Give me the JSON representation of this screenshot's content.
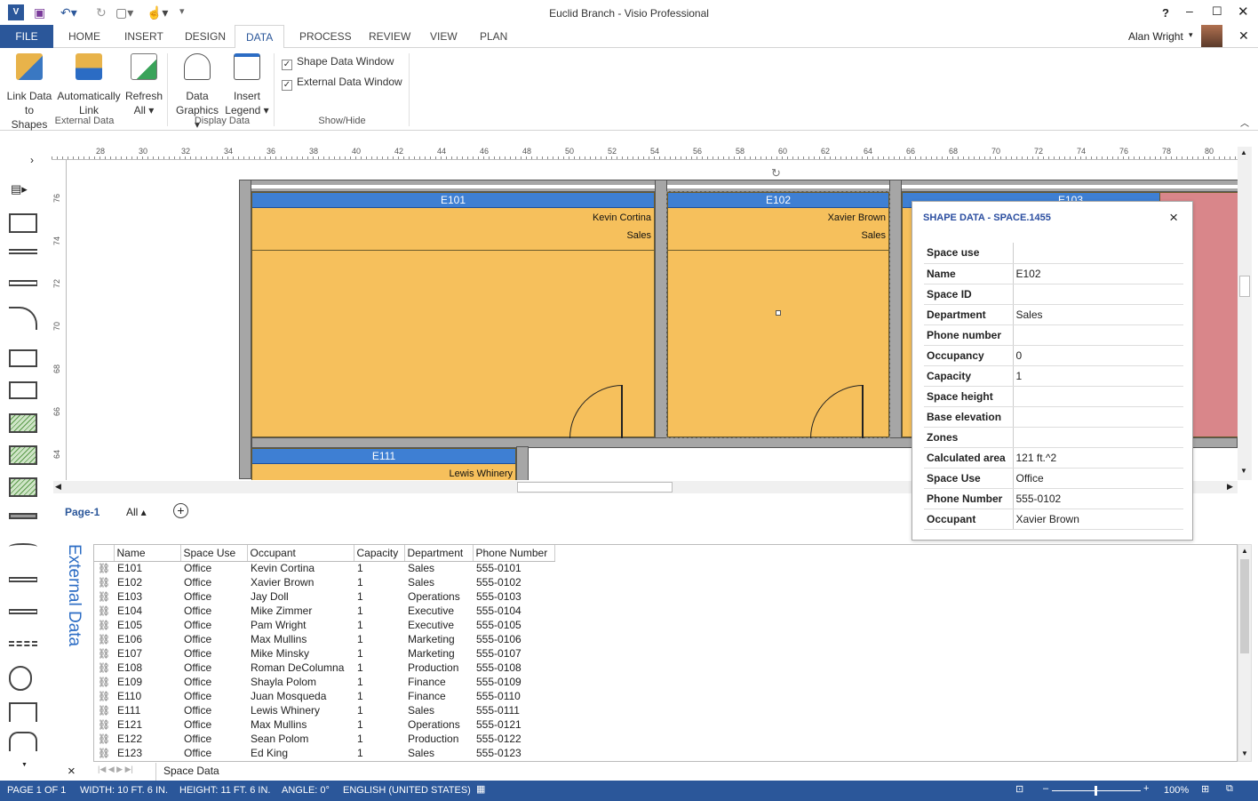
{
  "app": {
    "title": "Euclid Branch - Visio Professional",
    "user": "Alan Wright",
    "help": "?"
  },
  "tabs": [
    "FILE",
    "HOME",
    "INSERT",
    "DESIGN",
    "DATA",
    "PROCESS",
    "REVIEW",
    "VIEW",
    "PLAN"
  ],
  "active_tab": "DATA",
  "ribbon": {
    "link_data": [
      "Link Data",
      "to Shapes"
    ],
    "auto_link": [
      "Automatically",
      "Link"
    ],
    "refresh": [
      "Refresh",
      "All ▾"
    ],
    "data_graphics": [
      "Data",
      "Graphics ▾"
    ],
    "insert_legend": [
      "Insert",
      "Legend ▾"
    ],
    "shape_data_window": "Shape Data Window",
    "external_data_window": "External Data Window",
    "groups": [
      "External Data",
      "Display Data",
      "Show/Hide"
    ]
  },
  "ruler": {
    "h": [
      "28",
      "30",
      "32",
      "34",
      "36",
      "38",
      "40",
      "42",
      "44",
      "46",
      "48",
      "50",
      "52",
      "54",
      "56",
      "58",
      "60",
      "62",
      "64",
      "66",
      "68",
      "70",
      "72",
      "74",
      "76",
      "78",
      "80"
    ],
    "v": [
      "76",
      "74",
      "72",
      "70",
      "68",
      "66",
      "64"
    ]
  },
  "rooms": [
    {
      "name": "E101",
      "occupant": "Kevin Cortina",
      "dept": "Sales"
    },
    {
      "name": "E102",
      "occupant": "Xavier Brown",
      "dept": "Sales"
    },
    {
      "name": "E103"
    },
    {
      "name": "E111",
      "occupant": "Lewis Whinery"
    }
  ],
  "page": {
    "tab": "Page-1",
    "all": "All ▴",
    "add": "+"
  },
  "shape_data": {
    "title": "SHAPE DATA - SPACE.1455",
    "close": "×",
    "rows": [
      [
        "Space use",
        ""
      ],
      [
        "Name",
        "E102"
      ],
      [
        "Space ID",
        ""
      ],
      [
        "Department",
        "Sales"
      ],
      [
        "Phone number",
        ""
      ],
      [
        "Occupancy",
        "0"
      ],
      [
        "Capacity",
        "1"
      ],
      [
        "Space height",
        ""
      ],
      [
        "Base elevation",
        ""
      ],
      [
        "Zones",
        ""
      ],
      [
        "Calculated area",
        "121 ft.^2"
      ],
      [
        "Space Use",
        "Office"
      ],
      [
        "Phone Number",
        "555-0102"
      ],
      [
        "Occupant",
        "Xavier Brown"
      ]
    ]
  },
  "external": {
    "label": "External Data",
    "sheet": "Space Data",
    "close": "×",
    "columns": [
      "Name",
      "Space Use",
      "Occupant",
      "Capacity",
      "Department",
      "Phone Number"
    ],
    "rows": [
      [
        "E101",
        "Office",
        "Kevin Cortina",
        "1",
        "Sales",
        "555-0101"
      ],
      [
        "E102",
        "Office",
        "Xavier Brown",
        "1",
        "Sales",
        "555-0102"
      ],
      [
        "E103",
        "Office",
        "Jay Doll",
        "1",
        "Operations",
        "555-0103"
      ],
      [
        "E104",
        "Office",
        "Mike Zimmer",
        "1",
        "Executive",
        "555-0104"
      ],
      [
        "E105",
        "Office",
        "Pam Wright",
        "1",
        "Executive",
        "555-0105"
      ],
      [
        "E106",
        "Office",
        "Max Mullins",
        "1",
        "Marketing",
        "555-0106"
      ],
      [
        "E107",
        "Office",
        "Mike Minsky",
        "1",
        "Marketing",
        "555-0107"
      ],
      [
        "E108",
        "Office",
        "Roman DeColumna",
        "1",
        "Production",
        "555-0108"
      ],
      [
        "E109",
        "Office",
        "Shayla Polom",
        "1",
        "Finance",
        "555-0109"
      ],
      [
        "E110",
        "Office",
        "Juan Mosqueda",
        "1",
        "Finance",
        "555-0110"
      ],
      [
        "E111",
        "Office",
        "Lewis Whinery",
        "1",
        "Sales",
        "555-0111"
      ],
      [
        "E121",
        "Office",
        "Max Mullins",
        "1",
        "Operations",
        "555-0121"
      ],
      [
        "E122",
        "Office",
        "Sean Polom",
        "1",
        "Production",
        "555-0122"
      ],
      [
        "E123",
        "Office",
        "Ed King",
        "1",
        "Sales",
        "555-0123"
      ]
    ]
  },
  "status": {
    "page": "PAGE 1 OF 1",
    "width": "WIDTH: 10 FT. 6 IN.",
    "height": "HEIGHT: 11 FT. 6 IN.",
    "angle": "ANGLE: 0°",
    "language": "ENGLISH (UNITED STATES)",
    "zoom": "100%",
    "zoom_level_percent": 100
  },
  "colors": {
    "accent": "#2b579a",
    "room": "#f6c05c",
    "room_header": "#3e7fd3",
    "room_other": "#d9868a"
  }
}
